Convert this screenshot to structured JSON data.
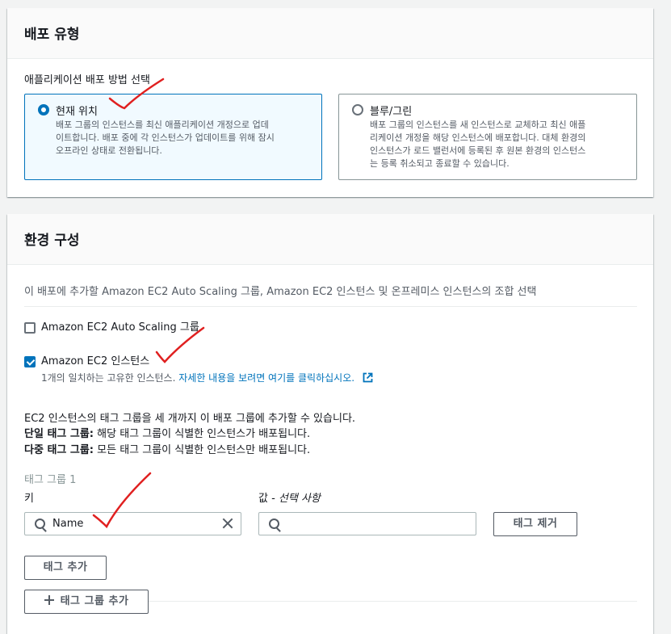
{
  "deployment_type": {
    "title": "배포 유형",
    "method_label": "애플리케이션 배포 방법 선택",
    "options": [
      {
        "title": "현재 위치",
        "desc_lines": [
          "배포 그룹의 인스턴스를 최신 애플리케이션 개정으로 업데",
          "이트합니다. 배포 중에 각 인스턴스가 업데이트를 위해 잠시",
          "오프라인 상태로 전환됩니다."
        ],
        "selected": true
      },
      {
        "title": "블루/그린",
        "desc_lines": [
          "배포 그룹의 인스턴스를 새 인스턴스로 교체하고 최신 애플",
          "리케이션 개정을 해당 인스턴스에 배포합니다. 대체 환경의",
          "인스턴스가 로드 밸런서에 등록된 후 원본 환경의 인스턴스",
          "는 등록 취소되고 종료할 수 있습니다."
        ],
        "selected": false
      }
    ]
  },
  "environment": {
    "title": "환경 구성",
    "description": "이 배포에 추가할 Amazon EC2 Auto Scaling 그룹, Amazon EC2 인스턴스 및 온프레미스 인스턴스의 조합 선택",
    "asg_label": "Amazon EC2 Auto Scaling 그룹",
    "asg_checked": false,
    "ec2_label": "Amazon EC2 인스턴스",
    "ec2_checked": true,
    "ec2_match_text": "1개의 일치하는 고유한 인스턴스.",
    "ec2_match_link": "자세한 내용을 보려면 여기를 클릭하십시오.",
    "tag_info_line1": "EC2 인스턴스의 태그 그룹을 세 개까지 이 배포 그룹에 추가할 수 있습니다.",
    "single_tag_bold": "단일 태그 그룹:",
    "single_tag_text": " 해당 태그 그룹이 식별한 인스턴스가 배포됩니다.",
    "multi_tag_bold": "다중 태그 그룹:",
    "multi_tag_text": " 모든 태그 그룹이 식별한 인스턴스만 배포됩니다.",
    "tag_group_label": "태그 그룹 1",
    "key_label": "키",
    "key_value": "Name",
    "value_label_main": "값",
    "value_label_opt": " - 선택 사항",
    "value_value": "",
    "remove_tag_button": "태그 제거",
    "add_tag_button": "태그 추가",
    "add_tag_group_button": "태그 그룹 추가"
  },
  "colors": {
    "accent": "#0073bb",
    "annotation": "#e02020"
  }
}
